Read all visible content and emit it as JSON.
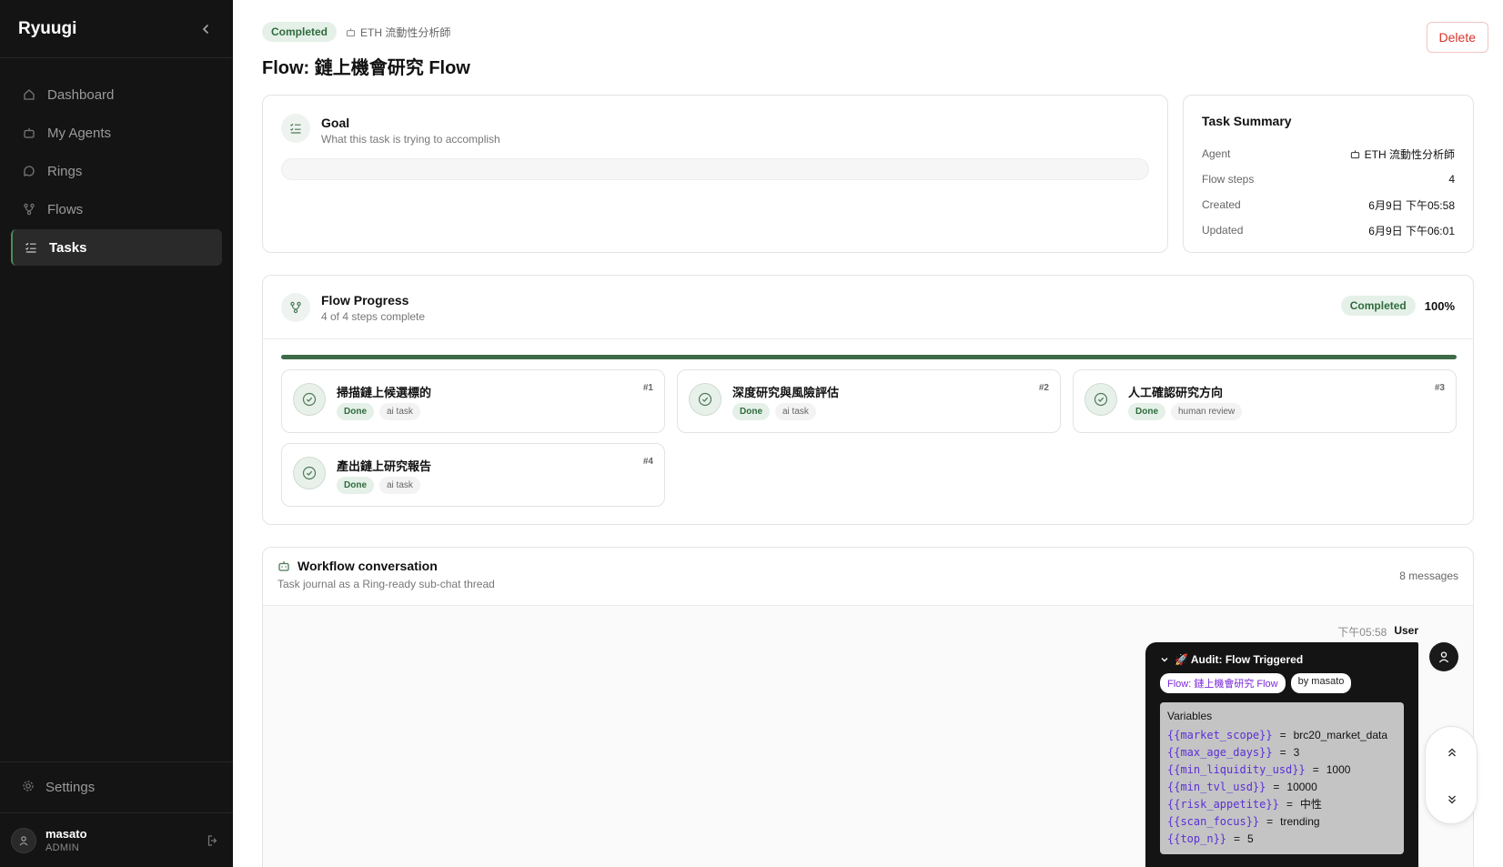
{
  "app": {
    "name": "Ryuugi"
  },
  "sidebar": {
    "items": [
      {
        "label": "Dashboard",
        "icon": "home-icon"
      },
      {
        "label": "My Agents",
        "icon": "bot-icon"
      },
      {
        "label": "Rings",
        "icon": "chat-icon"
      },
      {
        "label": "Flows",
        "icon": "flow-icon"
      },
      {
        "label": "Tasks",
        "icon": "tasks-icon",
        "active": true
      }
    ],
    "settings": "Settings",
    "user": {
      "name": "masato",
      "role": "ADMIN"
    }
  },
  "header": {
    "status": "Completed",
    "agent": "ETH 流動性分析師",
    "title": "Flow: 鏈上機會研究 Flow",
    "delete_label": "Delete"
  },
  "goal": {
    "title": "Goal",
    "subtitle": "What this task is trying to accomplish"
  },
  "summary": {
    "title": "Task Summary",
    "rows": [
      {
        "k": "Agent",
        "v": "ETH 流動性分析師"
      },
      {
        "k": "Flow steps",
        "v": "4"
      },
      {
        "k": "Created",
        "v": "6月9日 下午05:58"
      },
      {
        "k": "Updated",
        "v": "6月9日 下午06:01"
      }
    ]
  },
  "flow": {
    "title": "Flow Progress",
    "subtitle": "4 of 4 steps complete",
    "status": "Completed",
    "percent_label": "100%",
    "progress": 1.0,
    "steps": [
      {
        "title": "掃描鏈上候選標的",
        "num": "#1",
        "status": "Done",
        "type": "ai task"
      },
      {
        "title": "深度研究與風險評估",
        "num": "#2",
        "status": "Done",
        "type": "ai task"
      },
      {
        "title": "人工確認研究方向",
        "num": "#3",
        "status": "Done",
        "type": "human review"
      },
      {
        "title": "產出鏈上研究報告",
        "num": "#4",
        "status": "Done",
        "type": "ai task"
      }
    ]
  },
  "conversation": {
    "title": "Workflow conversation",
    "subtitle": "Task journal as a Ring-ready sub-chat thread",
    "count": "8 messages",
    "message": {
      "time": "下午05:58",
      "sender": "User",
      "title": "🚀 Audit: Flow Triggered",
      "flow_chip": "Flow: 鏈上機會研究 Flow",
      "by_chip": "by masato",
      "vars_title": "Variables",
      "vars": [
        {
          "key": "{{market_scope}}",
          "value": "brc20_market_data"
        },
        {
          "key": "{{max_age_days}}",
          "value": "3"
        },
        {
          "key": "{{min_liquidity_usd}}",
          "value": "1000"
        },
        {
          "key": "{{min_tvl_usd}}",
          "value": "10000"
        },
        {
          "key": "{{risk_appetite}}",
          "value": "中性"
        },
        {
          "key": "{{scan_focus}}",
          "value": "trending"
        },
        {
          "key": "{{top_n}}",
          "value": "5"
        }
      ]
    }
  },
  "colors": {
    "sidebar_bg": "#141414",
    "accent_green": "#3d6b47",
    "badge_green_bg": "#e5f1e8",
    "delete_red": "#d9342b",
    "var_key_purple": "#5b2fd6"
  }
}
